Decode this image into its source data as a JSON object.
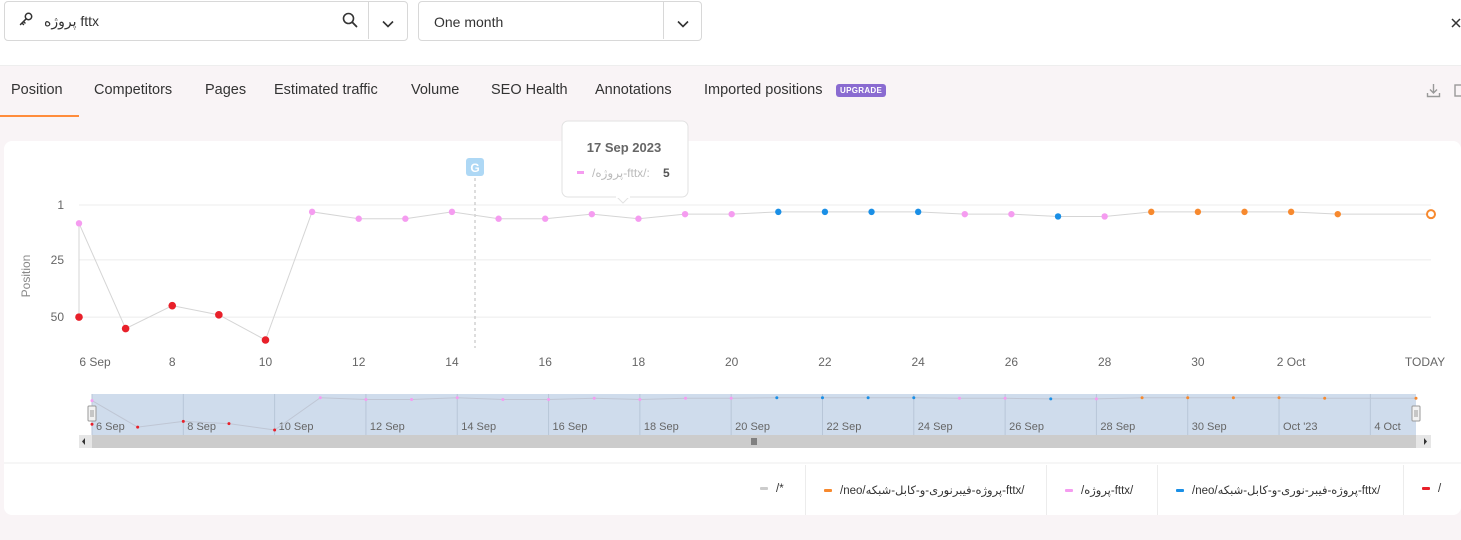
{
  "search": {
    "keyword": "پروژه fttx"
  },
  "period": {
    "selected": "One month"
  },
  "tabs": [
    {
      "label": "Position",
      "active": true
    },
    {
      "label": "Competitors"
    },
    {
      "label": "Pages"
    },
    {
      "label": "Estimated traffic"
    },
    {
      "label": "Volume"
    },
    {
      "label": "SEO Health"
    },
    {
      "label": "Annotations"
    },
    {
      "label": "Imported positions",
      "badge": "UPGRADE"
    }
  ],
  "colors": {
    "accent": "#ff8c3c",
    "red": "#e8202a",
    "pink": "#f59cf0",
    "blue": "#1a8fe6",
    "orange": "#f7892e",
    "gray": "#cccccc",
    "upgrade": "#8a6bd1"
  },
  "tooltip": {
    "date": "17 Sep 2023",
    "label": "/پروژه-fttx/:",
    "value": "5"
  },
  "annotation_marker": "G",
  "navigator": {
    "labels": [
      "6 Sep",
      "8 Sep",
      "10 Sep",
      "12 Sep",
      "14 Sep",
      "16 Sep",
      "18 Sep",
      "20 Sep",
      "22 Sep",
      "24 Sep",
      "26 Sep",
      "28 Sep",
      "30 Sep",
      "Oct '23",
      "4 Oct"
    ]
  },
  "legend": [
    {
      "label": "/*",
      "color": "#cccccc"
    },
    {
      "label": "/neo/پروژه-فیبرنوری-و-کابل-شبکه-fttx/",
      "color": "#f7892e"
    },
    {
      "label": "/پروژه-fttx/",
      "color": "#f59cf0"
    },
    {
      "label": "/neo/پروژه-فیبر-نوری-و-کابل-شبکه-fttx/",
      "color": "#1a8fe6"
    },
    {
      "label": "/",
      "color": "#e8202a"
    }
  ],
  "chart_data": {
    "type": "line",
    "title": "",
    "ylabel": "Position",
    "xlabel": "",
    "y_reversed": true,
    "yticks": [
      1,
      25,
      50
    ],
    "ylim": [
      1,
      60
    ],
    "xticks": [
      "6 Sep",
      "8",
      "10",
      "12",
      "14",
      "16",
      "18",
      "20",
      "22",
      "24",
      "26",
      "28",
      "30",
      "2 Oct",
      "TODAY"
    ],
    "x": [
      "6 Sep",
      "7 Sep",
      "8 Sep",
      "9 Sep",
      "10 Sep",
      "11 Sep",
      "12 Sep",
      "13 Sep",
      "14 Sep",
      "15 Sep",
      "16 Sep",
      "17 Sep",
      "18 Sep",
      "19 Sep",
      "20 Sep",
      "21 Sep",
      "22 Sep",
      "23 Sep",
      "24 Sep",
      "25 Sep",
      "26 Sep",
      "27 Sep",
      "28 Sep",
      "29 Sep",
      "30 Sep",
      "1 Oct",
      "2 Oct",
      "3 Oct",
      "4 Oct",
      "TODAY"
    ],
    "points": [
      {
        "x": "6 Sep",
        "y": 50,
        "series": "/"
      },
      {
        "x": "6 Sep",
        "y": 9,
        "series": "/پروژه-fttx/"
      },
      {
        "x": "7 Sep",
        "y": 55,
        "series": "/"
      },
      {
        "x": "8 Sep",
        "y": 45,
        "series": "/"
      },
      {
        "x": "9 Sep",
        "y": 49,
        "series": "/"
      },
      {
        "x": "10 Sep",
        "y": 60,
        "series": "/"
      },
      {
        "x": "11 Sep",
        "y": 4,
        "series": "/پروژه-fttx/"
      },
      {
        "x": "12 Sep",
        "y": 7,
        "series": "/پروژه-fttx/"
      },
      {
        "x": "13 Sep",
        "y": 7,
        "series": "/پروژه-fttx/"
      },
      {
        "x": "14 Sep",
        "y": 4,
        "series": "/پروژه-fttx/"
      },
      {
        "x": "15 Sep",
        "y": 7,
        "series": "/پروژه-fttx/"
      },
      {
        "x": "16 Sep",
        "y": 7,
        "series": "/پروژه-fttx/"
      },
      {
        "x": "17 Sep",
        "y": 5,
        "series": "/پروژه-fttx/"
      },
      {
        "x": "18 Sep",
        "y": 7,
        "series": "/پروژه-fttx/"
      },
      {
        "x": "19 Sep",
        "y": 5,
        "series": "/پروژه-fttx/"
      },
      {
        "x": "20 Sep",
        "y": 5,
        "series": "/پروژه-fttx/"
      },
      {
        "x": "21 Sep",
        "y": 4,
        "series": "/neo/پروژه-فیبر-نوری-و-کابل-شبکه-fttx/"
      },
      {
        "x": "22 Sep",
        "y": 4,
        "series": "/neo/پروژه-فیبر-نوری-و-کابل-شبکه-fttx/"
      },
      {
        "x": "23 Sep",
        "y": 4,
        "series": "/neo/پروژه-فیبر-نوری-و-کابل-شبکه-fttx/"
      },
      {
        "x": "24 Sep",
        "y": 4,
        "series": "/neo/پروژه-فیبر-نوری-و-کابل-شبکه-fttx/"
      },
      {
        "x": "25 Sep",
        "y": 5,
        "series": "/پروژه-fttx/"
      },
      {
        "x": "26 Sep",
        "y": 5,
        "series": "/پروژه-fttx/"
      },
      {
        "x": "27 Sep",
        "y": 6,
        "series": "/neo/پروژه-فیبر-نوری-و-کابل-شبکه-fttx/"
      },
      {
        "x": "28 Sep",
        "y": 6,
        "series": "/پروژه-fttx/"
      },
      {
        "x": "29 Sep",
        "y": 4,
        "series": "/neo/پروژه-فیبرنوری-و-کابل-شبکه-fttx/"
      },
      {
        "x": "30 Sep",
        "y": 4,
        "series": "/neo/پروژه-فیبرنوری-و-کابل-شبکه-fttx/"
      },
      {
        "x": "1 Oct",
        "y": 4,
        "series": "/neo/پروژه-فیبرنوری-و-کابل-شبکه-fttx/"
      },
      {
        "x": "2 Oct",
        "y": 4,
        "series": "/neo/پروژه-فیبرنوری-و-کابل-شبکه-fttx/"
      },
      {
        "x": "3 Oct",
        "y": 5,
        "series": "/neo/پروژه-فیبرنوری-و-کابل-شبکه-fttx/"
      },
      {
        "x": "TODAY",
        "y": 5,
        "series": "/neo/پروژه-فیبرنوری-و-کابل-شبکه-fttx/"
      }
    ],
    "grid": true,
    "legend_position": "bottom"
  }
}
